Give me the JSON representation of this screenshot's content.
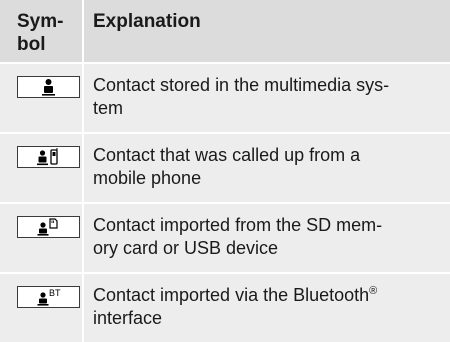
{
  "header": {
    "symbol_line1": "Sym-",
    "symbol_line2": "bol",
    "explanation": "Explanation"
  },
  "rows": [
    {
      "icon": "contact-person-icon",
      "line1": "Contact stored in the multimedia sys-",
      "line2": "tem"
    },
    {
      "icon": "contact-mobile-phone-icon",
      "line1": "Contact that was called up from a",
      "line2": "mobile phone"
    },
    {
      "icon": "contact-sd-card-icon",
      "line1": "Contact imported from the SD mem-",
      "line2": "ory card or USB device"
    },
    {
      "icon": "contact-bluetooth-icon",
      "icon_text": "BT",
      "line1_a": "Contact imported via the Bluetooth",
      "line1_sup": "®",
      "line2": "interface"
    }
  ],
  "colors": {
    "header_bg": "#dcdcdc",
    "row_bg": "#ededed",
    "text": "#1a1a1a"
  }
}
